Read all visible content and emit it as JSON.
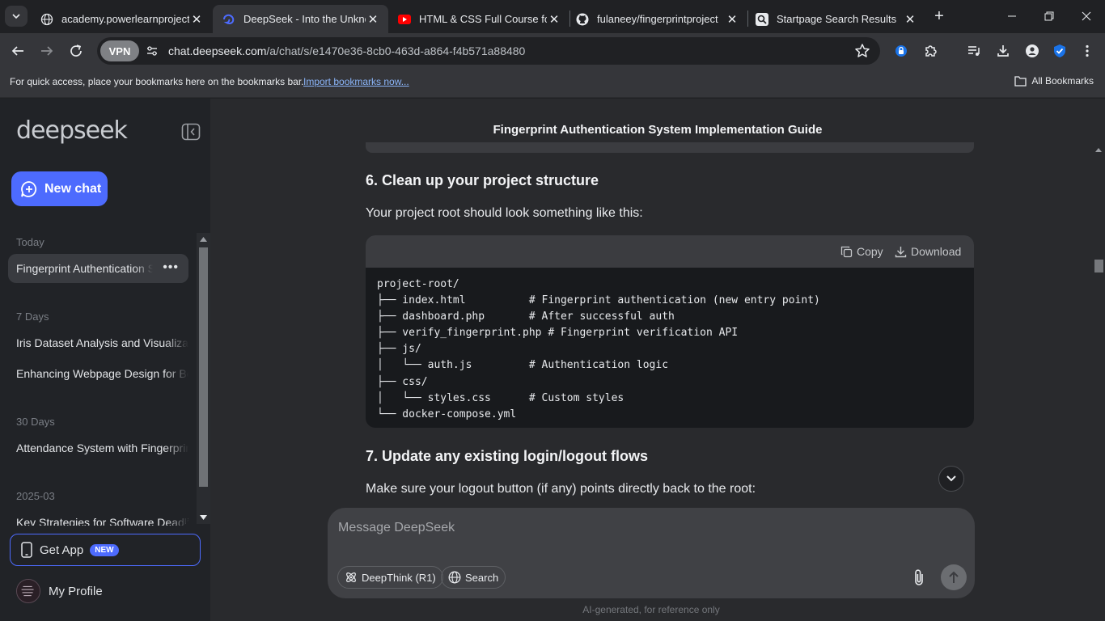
{
  "browser": {
    "tabs": [
      {
        "title": "academy.powerlearnprojecta",
        "favicon": "globe-icon",
        "active": false
      },
      {
        "title": "DeepSeek - Into the Unknow",
        "favicon": "deepseek-whale-icon",
        "active": true
      },
      {
        "title": "HTML & CSS Full Course for",
        "favicon": "youtube-icon",
        "active": false
      },
      {
        "title": "fulaneey/fingerprintproject",
        "favicon": "github-icon",
        "active": false
      },
      {
        "title": "Startpage Search Results",
        "favicon": "startpage-icon",
        "active": false
      }
    ],
    "vpn_label": "VPN",
    "url_host": "chat.deepseek.com",
    "url_path": "/a/chat/s/e1470e36-8cb0-463d-a864-f4b571a88480",
    "bookmarks_bar": {
      "message": "For quick access, place your bookmarks here on the bookmarks bar.",
      "import_link": "Import bookmarks now...",
      "all_bookmarks": "All Bookmarks"
    }
  },
  "sidebar": {
    "logo": "deepseek",
    "new_chat": "New chat",
    "groups": [
      {
        "label": "Today",
        "items": [
          {
            "title": "Fingerprint Authentication System Implementation Guide",
            "active": true
          }
        ]
      },
      {
        "label": "7 Days",
        "items": [
          {
            "title": "Iris Dataset Analysis and Visualization",
            "active": false
          },
          {
            "title": "Enhancing Webpage Design for Better UX",
            "active": false
          }
        ]
      },
      {
        "label": "30 Days",
        "items": [
          {
            "title": "Attendance System with Fingerprint",
            "active": false
          }
        ]
      },
      {
        "label": "2025-03",
        "items": [
          {
            "title": "Key Strategies for Software Deadlines",
            "active": false
          }
        ]
      }
    ],
    "get_app": "Get App",
    "get_app_badge": "NEW",
    "profile": "My Profile"
  },
  "chat": {
    "title": "Fingerprint Authentication System Implementation Guide",
    "step6_heading": "6. Clean up your project structure",
    "step6_text": "Your project root should look something like this:",
    "code": {
      "copy_label": "Copy",
      "download_label": "Download",
      "content": "project-root/\n├── index.html          # Fingerprint authentication (new entry point)\n├── dashboard.php       # After successful auth\n├── verify_fingerprint.php # Fingerprint verification API\n├── js/\n│   └── auth.js         # Authentication logic\n├── css/\n│   └── styles.css      # Custom styles\n└── docker-compose.yml"
    },
    "step7_heading": "7. Update any existing login/logout flows",
    "step7_text": "Make sure your logout button (if any) points directly back to the root:"
  },
  "composer": {
    "placeholder": "Message DeepSeek",
    "deepthink_label": "DeepThink (R1)",
    "search_label": "Search"
  },
  "footnote": "AI-generated, for reference only",
  "colors": {
    "accent": "#4d6bfe",
    "sidebar_bg": "#212327",
    "main_bg": "#292a2d",
    "browser_bg": "#202124"
  }
}
